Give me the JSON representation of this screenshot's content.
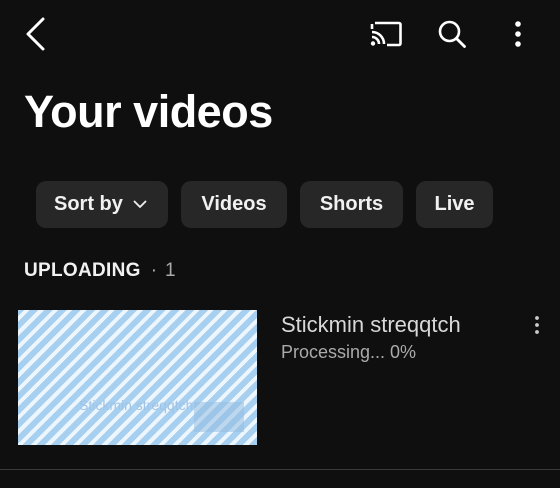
{
  "topbar": {
    "back_icon": "chevron-left-icon",
    "cast_icon": "cast-icon",
    "search_icon": "search-icon",
    "more_icon": "more-vertical-icon"
  },
  "page": {
    "title": "Your videos"
  },
  "filters": {
    "sort_label": "Sort by",
    "chips": [
      "Videos",
      "Shorts",
      "Live"
    ]
  },
  "section": {
    "title": "UPLOADING",
    "separator": "·",
    "count": "1"
  },
  "upload": {
    "title": "Stickmin streqqtch",
    "status": "Processing... 0%",
    "thumbnail_caption": "Stickmin streqqtch"
  },
  "colors": {
    "background": "#0f0f0f",
    "chip_background": "#272727",
    "text_primary": "#f1f1f1",
    "text_secondary": "#aaaaaa",
    "thumbnail_stripe": "#a7cff0"
  }
}
